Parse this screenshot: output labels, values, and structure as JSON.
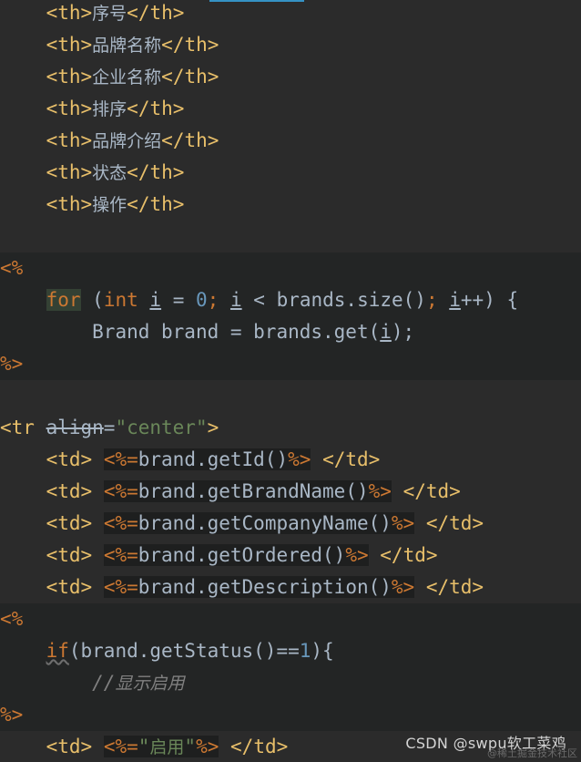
{
  "code": {
    "th_lines": [
      "序号",
      "品牌名称",
      "企业名称",
      "排序",
      "品牌介绍",
      "状态",
      "操作"
    ],
    "tag_open_th": "<th>",
    "tag_close_th": "</th>",
    "jsp_open": "<%",
    "jsp_close": "%>",
    "for_keyword": "for",
    "for_open_paren": " (",
    "int_keyword": "int",
    "loop_var": "i",
    "assign": " = ",
    "zero": "0",
    "semi": ";",
    "less_than": " < ",
    "size_call": "brands.size()",
    "increment": "++",
    "loop_end": ") {",
    "brand_decl": "Brand brand = brands.get(",
    "brand_decl_end": ");",
    "tr_open_prefix": "<tr ",
    "tr_attr": "align",
    "tr_eq": "=",
    "tr_value": "\"center\"",
    "tr_close": ">",
    "td_open": "<td>",
    "td_close": "</td>",
    "expr_open": "<%=",
    "expr_close": "%>",
    "td_exprs": [
      "brand.getId()",
      "brand.getBrandName()",
      "brand.getCompanyName()",
      "brand.getOrdered()",
      "brand.getDescription()"
    ],
    "if_keyword": "if",
    "if_cond_start": "(brand.getStatus()==",
    "one": "1",
    "if_cond_end": "){",
    "comment_slashes": "//",
    "comment_text": "显示启用",
    "enabled_str_quote_open": "\"",
    "enabled_str": "启用",
    "enabled_str_quote_close": "\""
  },
  "watermark": {
    "text": "CSDN @swpu软工菜鸡",
    "sub": "@稀土掘金技术社区"
  },
  "colors": {
    "background": "#2b2b2b",
    "jsp_block_background": "#232525",
    "tag": "#e8bf6a",
    "keyword": "#cc7832",
    "number": "#6897bb",
    "string": "#6a8759",
    "comment": "#808080",
    "text": "#a9b7c6",
    "scroll_indicator": "#3592c4"
  }
}
